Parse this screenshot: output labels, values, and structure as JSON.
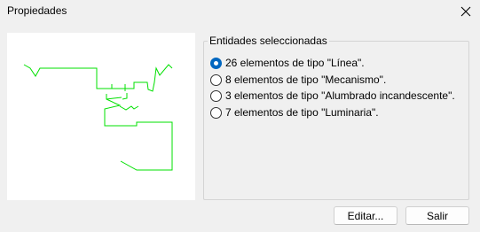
{
  "window": {
    "title": "Propiedades",
    "close_icon": "close-icon"
  },
  "selection": {
    "group_label": "Entidades seleccionadas",
    "options": [
      {
        "label": "26 elementos de tipo \"Línea\".",
        "checked": true
      },
      {
        "label": "8 elementos de tipo \"Mecanismo\".",
        "checked": false
      },
      {
        "label": "3 elementos de tipo \"Alumbrado incandescente\".",
        "checked": false
      },
      {
        "label": "7 elementos de tipo \"Luminaria\".",
        "checked": false
      }
    ]
  },
  "preview": {
    "line_color": "#00e000"
  },
  "buttons": {
    "edit_label": "Editar...",
    "exit_label": "Salir"
  }
}
